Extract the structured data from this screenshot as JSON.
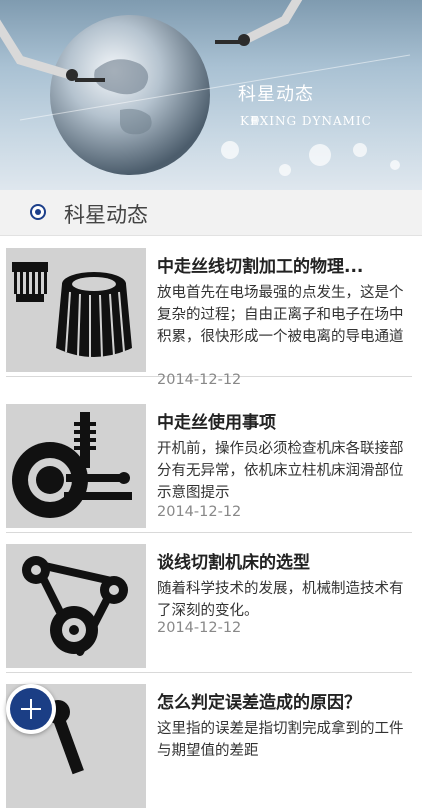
{
  "banner": {
    "title": "科星动态",
    "subtitle": "KEXING DYNAMIC"
  },
  "section": {
    "title": "科星动态"
  },
  "articles": [
    {
      "title": "中走丝线切割加工的物理...",
      "desc": "放电首先在电场最强的点发生，这是个复杂的过程；自由正离子和电子在场中积累，很快形成一个被电离的导电通道",
      "date": "2014-12-12",
      "icon": "air-filter-icon"
    },
    {
      "title": "中走丝使用事项",
      "desc": "开机前，操作员必须检查机床各联接部分有无异常，依机床立柱机床润滑部位示意图提示",
      "date": "2014-12-12",
      "icon": "wheel-suspension-icon"
    },
    {
      "title": "谈线切割机床的选型",
      "desc": "随着科学技术的发展，机械制造技术有了深刻的变化。",
      "date": "2014-12-12",
      "icon": "timing-belt-icon"
    },
    {
      "title": "怎么判定误差造成的原因？",
      "desc": "这里指的误差是指切割完成拿到的工件与期望值的差距",
      "date": "",
      "icon": "wrench-icon"
    }
  ],
  "fab": {
    "icon": "plus-icon"
  }
}
